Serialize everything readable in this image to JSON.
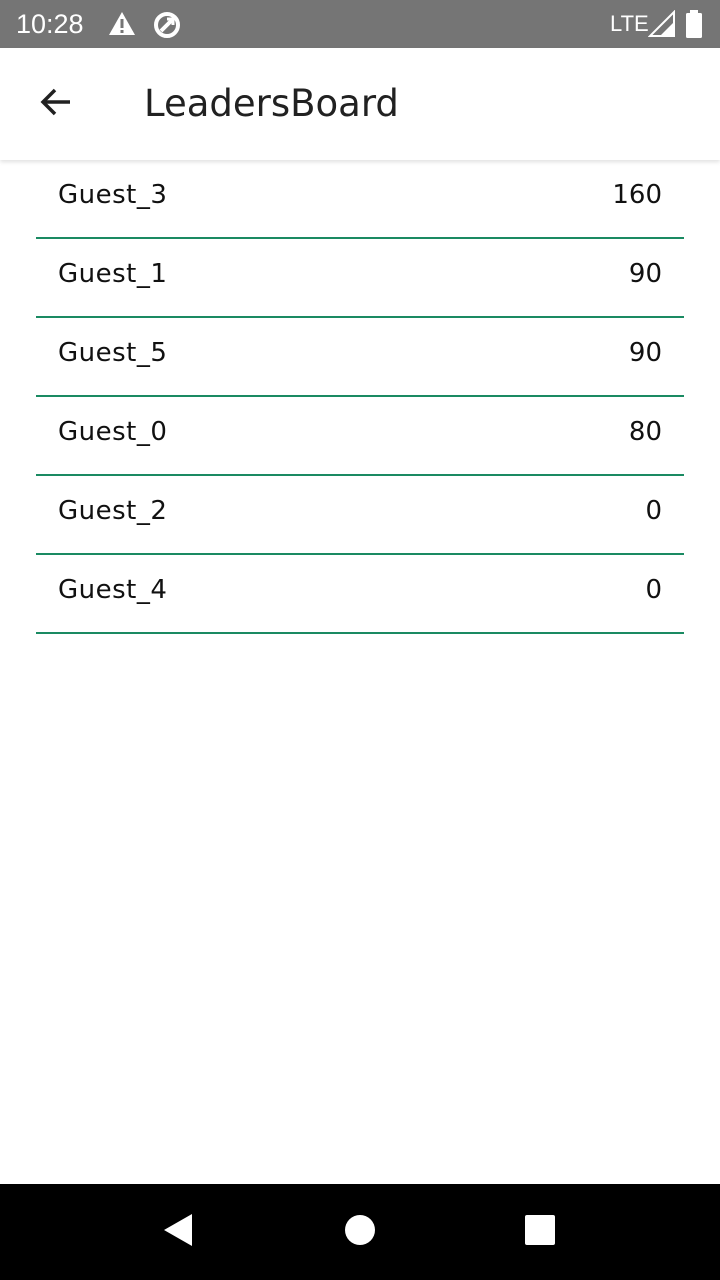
{
  "status_bar": {
    "time": "10:28",
    "network": "LTE",
    "icons": [
      "warning-icon",
      "data-saver-icon",
      "signal-icon",
      "battery-icon"
    ]
  },
  "app_bar": {
    "title": "LeadersBoard",
    "back_icon": "arrow-left-icon"
  },
  "leaderboard": {
    "divider_color": "#1a8a62",
    "rows": [
      {
        "name": "Guest_3",
        "score": "160"
      },
      {
        "name": "Guest_1",
        "score": "90"
      },
      {
        "name": "Guest_5",
        "score": "90"
      },
      {
        "name": "Guest_0",
        "score": "80"
      },
      {
        "name": "Guest_2",
        "score": "0"
      },
      {
        "name": "Guest_4",
        "score": "0"
      }
    ]
  },
  "nav_bar": {
    "buttons": [
      "back-triangle-icon",
      "home-circle-icon",
      "recents-square-icon"
    ]
  }
}
